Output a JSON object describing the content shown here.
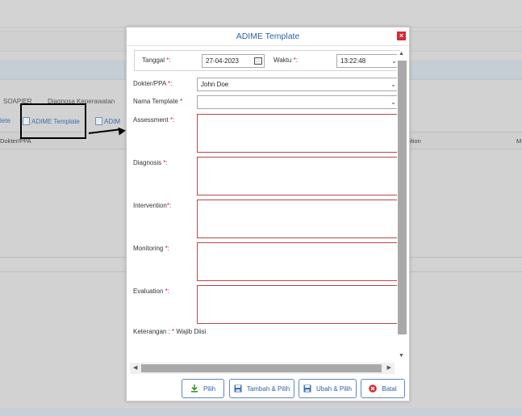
{
  "background": {
    "tabs": [
      "SOAPIER",
      "Diagnosa Keperawatan"
    ],
    "toolbar": {
      "delete_label": "lete",
      "adime_template_label": "ADIME Template",
      "adime_label": "ADIM"
    },
    "columns": [
      "Dokter/PPA",
      "ition",
      "M"
    ]
  },
  "dialog": {
    "title": "ADIME Template",
    "close_label": "×",
    "fields": {
      "tanggal_label": "Tanggal",
      "tanggal_value": "27-04-2023",
      "waktu_label": "Waktu",
      "waktu_value": "13:22:48",
      "dokter_label": "Dokter/PPA",
      "dokter_value": "John Doe",
      "nama_template_label": "Nama Template",
      "nama_template_value": "",
      "assessment_label": "Assessment",
      "diagnosis_label": "Diagnosis",
      "intervention_label": "Intervention",
      "monitoring_label": "Monitoring",
      "evaluation_label": "Evaluation",
      "required_mark": "*"
    },
    "note": {
      "prefix": "Keterangan : ",
      "mark": "*",
      "text": " Wajib Diisi"
    },
    "buttons": {
      "pilih": "Pilih",
      "tambah_pilih": "Tambah & Pilih",
      "ubah_pilih": "Ubah & Pilih",
      "batal": "Batal"
    }
  },
  "colors": {
    "accent": "#2b5fa8",
    "required": "#d0202a",
    "close": "#d9282f"
  }
}
